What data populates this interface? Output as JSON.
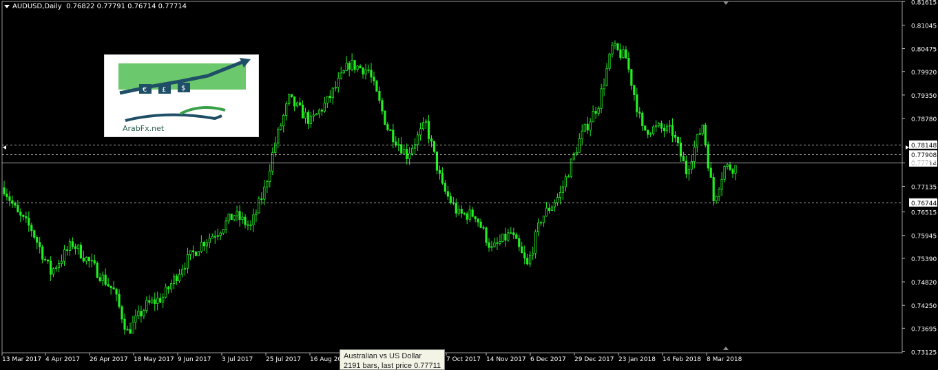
{
  "header": {
    "symbol": "AUDUSD,Daily",
    "ohlc": "0.76822 0.77791 0.76714 0.77714"
  },
  "logo": {
    "site": "ArabFx.net"
  },
  "tooltip": {
    "line1": "Australian vs US Dollar",
    "line2": "2191 bars, last price 0.77711"
  },
  "colors": {
    "background": "#000000",
    "candle": "#22ee22",
    "grid": "#ffffff",
    "text": "#ffffff"
  },
  "chart_data": {
    "type": "candlestick",
    "ylim": [
      0.731,
      0.8162
    ],
    "y_ticks": [
      "0.81615",
      "0.81045",
      "0.80475",
      "0.79920",
      "0.79350",
      "0.78780",
      "0.78148",
      "0.77908",
      "0.77714",
      "0.77705",
      "0.77135",
      "0.76744",
      "0.76515",
      "0.75945",
      "0.75390",
      "0.74820",
      "0.74250",
      "0.73695",
      "0.73125"
    ],
    "x_ticks": [
      "13 Mar 2017",
      "4 Apr 2017",
      "26 Apr 2017",
      "18 May 2017",
      "9 Jun 2017",
      "3 Jul 2017",
      "25 Jul 2017",
      "16 Aug 2017",
      "7 Oct 2017",
      "14 Nov 2017",
      "6 Dec 2017",
      "29 Dec 2017",
      "23 Jan 2018",
      "14 Feb 2018",
      "8 Mar 2018"
    ],
    "price_lines": [
      {
        "value": 0.78148,
        "label": "0.78148",
        "style": "dashed"
      },
      {
        "value": 0.77908,
        "label": "0.77908",
        "style": "dashed"
      },
      {
        "value": 0.77714,
        "label": "0.77714",
        "style": "solid"
      },
      {
        "value": 0.76744,
        "label": "0.76744",
        "style": "dashed"
      }
    ],
    "x_range": [
      0,
      267
    ],
    "anchors": [
      [
        0,
        0.771
      ],
      [
        5,
        0.7645
      ],
      [
        10,
        0.761
      ],
      [
        17,
        0.7505
      ],
      [
        25,
        0.7575
      ],
      [
        33,
        0.7515
      ],
      [
        40,
        0.746
      ],
      [
        45,
        0.736
      ],
      [
        52,
        0.7425
      ],
      [
        58,
        0.7445
      ],
      [
        65,
        0.752
      ],
      [
        72,
        0.7575
      ],
      [
        78,
        0.7605
      ],
      [
        84,
        0.7645
      ],
      [
        90,
        0.7615
      ],
      [
        95,
        0.7705
      ],
      [
        99,
        0.782
      ],
      [
        104,
        0.7925
      ],
      [
        112,
        0.787
      ],
      [
        118,
        0.792
      ],
      [
        126,
        0.801
      ],
      [
        133,
        0.7995
      ],
      [
        140,
        0.7855
      ],
      [
        147,
        0.779
      ],
      [
        154,
        0.7865
      ],
      [
        160,
        0.771
      ],
      [
        166,
        0.7645
      ],
      [
        172,
        0.7645
      ],
      [
        178,
        0.756
      ],
      [
        185,
        0.76
      ],
      [
        191,
        0.752
      ],
      [
        196,
        0.7635
      ],
      [
        203,
        0.7695
      ],
      [
        210,
        0.7825
      ],
      [
        217,
        0.7915
      ],
      [
        222,
        0.805
      ],
      [
        227,
        0.8025
      ],
      [
        233,
        0.785
      ],
      [
        239,
        0.7855
      ],
      [
        244,
        0.7845
      ],
      [
        249,
        0.775
      ],
      [
        255,
        0.7865
      ],
      [
        259,
        0.768
      ],
      [
        263,
        0.776
      ]
    ]
  }
}
